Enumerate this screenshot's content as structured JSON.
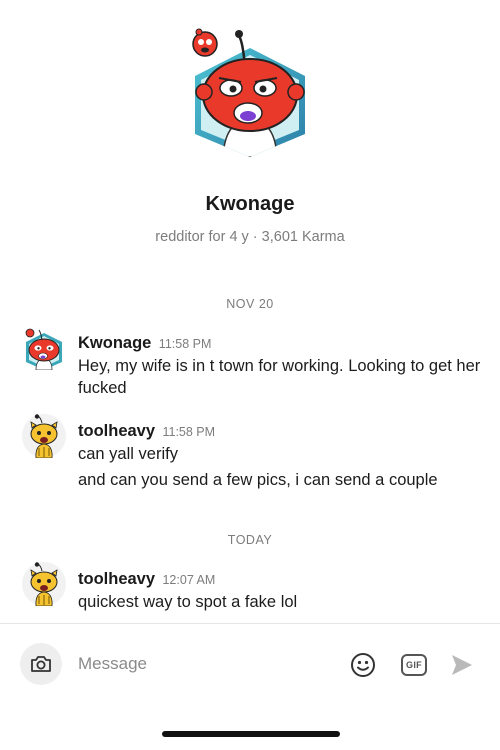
{
  "profile": {
    "name": "Kwonage",
    "meta": "redditor for 4 y · 3,601 Karma"
  },
  "date_separators": {
    "first": "NOV 20",
    "second": "TODAY"
  },
  "messages": [
    {
      "user": "Kwonage",
      "time": "11:58 PM",
      "lines": [
        "Hey, my wife is in t town for working. Looking to get her fucked"
      ]
    },
    {
      "user": "toolheavy",
      "time": "11:58 PM",
      "lines": [
        "can yall verify",
        "and can you send a few pics, i can send a couple"
      ]
    },
    {
      "user": "toolheavy",
      "time": "12:07 AM",
      "lines": [
        "quickest way to spot a fake lol"
      ]
    }
  ],
  "composer": {
    "placeholder": "Message",
    "gif_label": "GIF"
  },
  "icons": {
    "camera": "camera-icon",
    "emoji": "emoji-icon",
    "gif": "gif-icon",
    "send": "send-icon"
  },
  "colors": {
    "avatar_hex_teal": "#3aa8b8",
    "avatar_face_red": "#e8392b",
    "snoo_yellow": "#f5c230",
    "send_disabled": "#b9b9b9"
  }
}
